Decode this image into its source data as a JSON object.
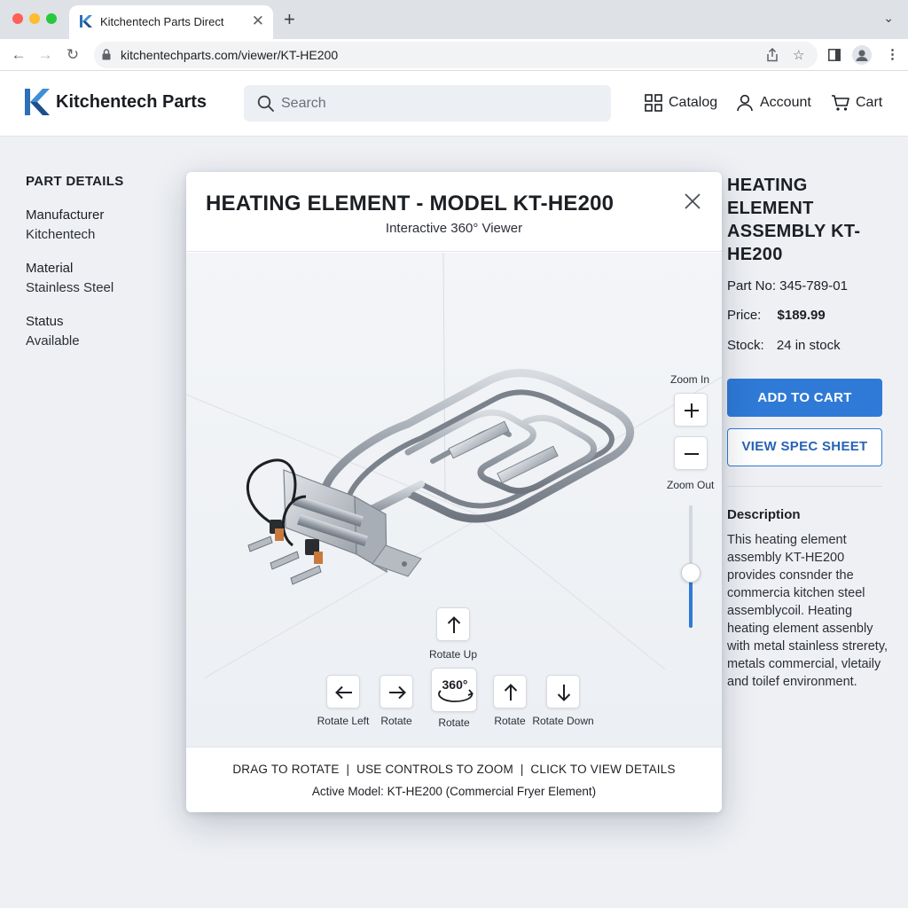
{
  "browser": {
    "tab_title": "Kitchentech Parts Direct",
    "url": "kitchentechparts.com/viewer/KT-HE200",
    "icons": [
      "back-icon",
      "forward-icon",
      "reload-icon",
      "lock-icon",
      "share-icon",
      "bookmark-star-icon",
      "sidebar-icon",
      "profile-icon",
      "more-icon"
    ]
  },
  "header": {
    "logo_text": "Kitchentech Parts",
    "search_placeholder": "Search",
    "nav": [
      {
        "label": "Catalog",
        "icon": "grid-icon"
      },
      {
        "label": "Account",
        "icon": "user-icon"
      },
      {
        "label": "Cart",
        "icon": "cart-icon"
      }
    ]
  },
  "part_details": {
    "title": "PART DETAILS",
    "fields": [
      {
        "label": "Manufacturer",
        "value": "Kitchentech"
      },
      {
        "label": "Material",
        "value": "Stainless Steel"
      },
      {
        "label": "Status",
        "value": "Available"
      }
    ]
  },
  "product": {
    "title": "HEATING ELEMENT ASSEMBLY KT-HE200",
    "part_no": "Part No: 345-789-01",
    "price_label": "Price:",
    "price_value": "$189.99",
    "stock_label": "Stock:",
    "stock_value": "24 in stock",
    "add_to_cart": "ADD TO CART",
    "view_spec": "VIEW SPEC SHEET",
    "description_title": "Description",
    "description": "This heating element assembly KT-HE200 provides consnder the commercia kitchen steel assemblycoil. Heating heating element assenbly with metal stainless strerety, metals commercial, vletaily and toilef environment.",
    "accent_color": "#2f7ad6"
  },
  "viewer": {
    "title": "HEATING ELEMENT - MODEL KT-HE200",
    "subtitle": "Interactive 360° Viewer",
    "zoom_in_label": "Zoom In",
    "zoom_out_label": "Zoom Out",
    "zoom_level": 0.45,
    "rotate_up": "Rotate Up",
    "rotate_left": "Rotate Left",
    "rotate_right": "Rotate",
    "rotate_360": "Rotate",
    "rotate_360_badge": "360°",
    "rotate_up2": "Rotate",
    "rotate_down": "Rotate Down",
    "footer_instructions": "DRAG TO ROTATE  |  USE CONTROLS TO ZOOM  |  CLICK TO VIEW DETAILS",
    "active_model": "Active Model: KT-HE200 (Commercial Fryer Element)"
  }
}
